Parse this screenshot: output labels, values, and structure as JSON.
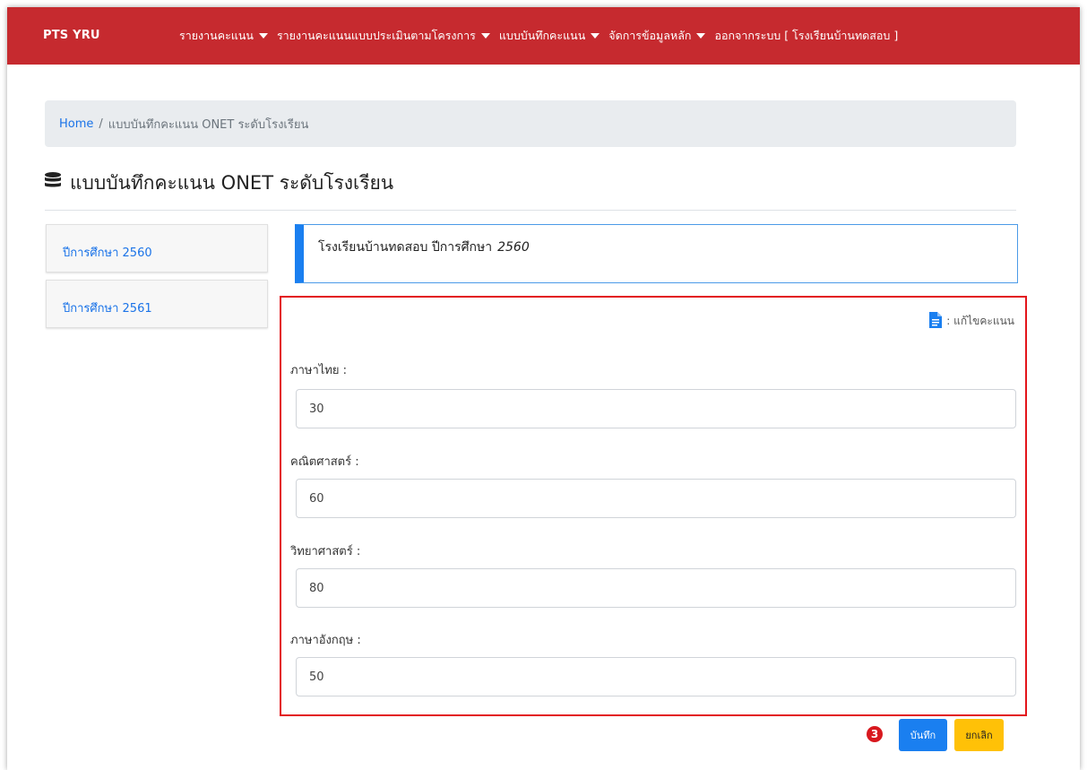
{
  "navbar": {
    "brand": "PTS YRU",
    "items": [
      {
        "label": "รายงานคะแนน",
        "dropdown": true
      },
      {
        "label": "รายงานคะแนนแบบประเมินตามโครงการ",
        "dropdown": true
      },
      {
        "label": "แบบบันทึกคะแนน",
        "dropdown": true
      },
      {
        "label": "จัดการข้อมูลหลัก",
        "dropdown": true
      },
      {
        "label": "ออกจากระบบ [ โรงเรียนบ้านทดสอบ ]",
        "dropdown": false
      }
    ]
  },
  "breadcrumb": {
    "home": "Home",
    "separator": "/",
    "current": "แบบบันทึกคะแนน ONET ระดับโรงเรียน"
  },
  "page": {
    "title": "แบบบันทึกคะแนน ONET ระดับโรงเรียน",
    "title_icon": "database-icon"
  },
  "sidebar": {
    "items": [
      {
        "label": "ปีการศึกษา 2560"
      },
      {
        "label": "ปีการศึกษา 2561"
      }
    ]
  },
  "callout": {
    "text": "โรงเรียนบ้านทดสอบ ปีการศึกษา",
    "year": "2560"
  },
  "form": {
    "edit_note": ": แก้ไขคะแนน",
    "edit_icon": "document-icon",
    "fields": [
      {
        "label": "ภาษาไทย :",
        "value": "30"
      },
      {
        "label": "คณิตศาสตร์ :",
        "value": "60"
      },
      {
        "label": "วิทยาศาสตร์ :",
        "value": "80"
      },
      {
        "label": "ภาษาอังกฤษ :",
        "value": "50"
      }
    ]
  },
  "actions": {
    "step_badge": "3",
    "save_label": "บันทึก",
    "cancel_label": "ยกเลิก"
  },
  "colors": {
    "navbar": "#c62a2f",
    "primary": "#1a7ff0",
    "warning": "#ffc107",
    "highlight": "#e3151b"
  }
}
